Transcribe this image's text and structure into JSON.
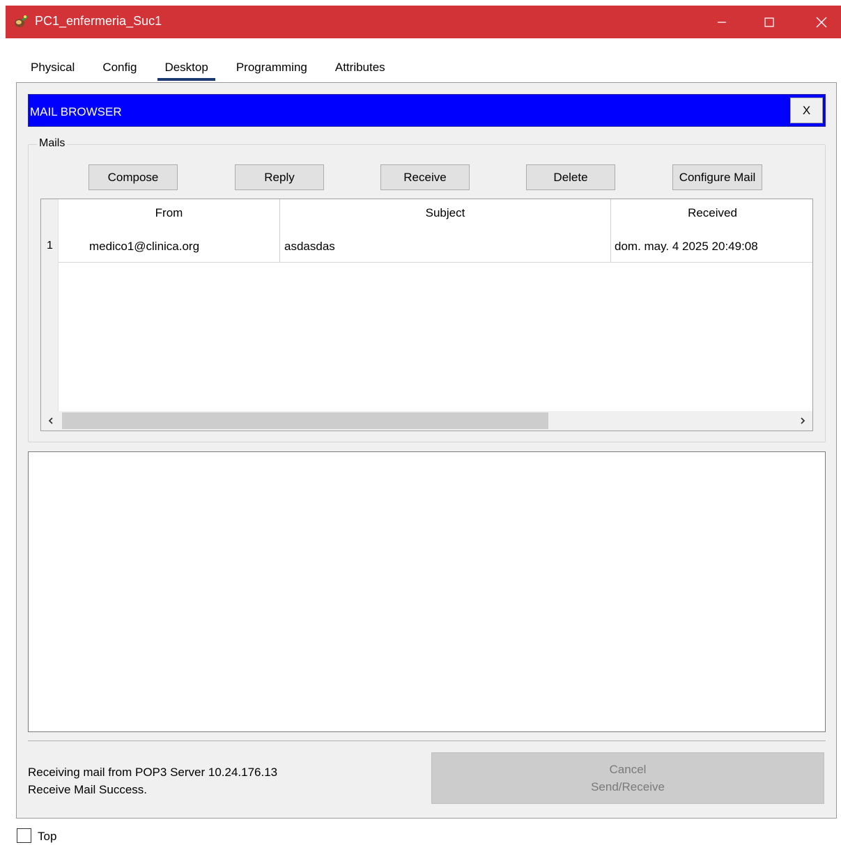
{
  "window": {
    "title": "PC1_enfermeria_Suc1",
    "title_bar_color": "#d23337",
    "icons": {
      "minimize": "minimize-icon",
      "maximize": "maximize-icon",
      "close": "close-icon",
      "app": "app-icon"
    }
  },
  "tabs": [
    {
      "label": "Physical",
      "active": false
    },
    {
      "label": "Config",
      "active": false
    },
    {
      "label": "Desktop",
      "active": true
    },
    {
      "label": "Programming",
      "active": false
    },
    {
      "label": "Attributes",
      "active": false
    }
  ],
  "mail_browser": {
    "title": "MAIL BROWSER",
    "close_label": "X",
    "header_color": "#0000ff",
    "mails_group_label": "Mails",
    "buttons": {
      "compose": "Compose",
      "reply": "Reply",
      "receive": "Receive",
      "delete": "Delete",
      "configure": "Configure Mail"
    },
    "table": {
      "columns": [
        "From",
        "Subject",
        "Received"
      ],
      "rows": [
        {
          "num": "1",
          "from": "medico1@clinica.org",
          "subject": "asdasdas",
          "received": "dom. may. 4 2025 20:49:08"
        }
      ]
    }
  },
  "status": {
    "line1": "Receiving mail from POP3 Server 10.24.176.13",
    "line2": "Receive Mail Success."
  },
  "cancel_button": {
    "line1": "Cancel",
    "line2": "Send/Receive",
    "enabled": false
  },
  "top_checkbox": {
    "label": "Top",
    "checked": false
  }
}
